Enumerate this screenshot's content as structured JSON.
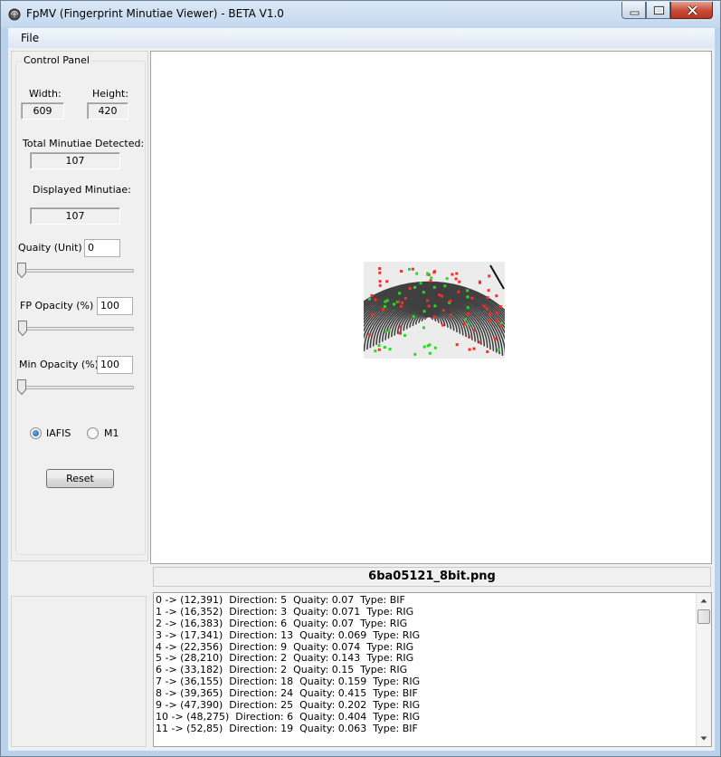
{
  "window": {
    "title": "FpMV (Fingerprint Minutiae Viewer) - BETA V1.0",
    "controls": [
      "minimize-icon",
      "maximize-icon",
      "close-icon"
    ]
  },
  "menu": {
    "file_label": "File"
  },
  "control_panel": {
    "title": "Control Panel",
    "width_label": "Width:",
    "width_value": "609",
    "height_label": "Height:",
    "height_value": "420",
    "total_label": "Total Minutiae Detected:",
    "total_value": "107",
    "displayed_label": "Displayed Minutiae:",
    "displayed_value": "107",
    "quality_label": "Quaity (Unit) >",
    "quality_value": "0",
    "quality_slider_level": 0,
    "fp_opacity_label": "FP Opacity (%)  >",
    "fp_opacity_value": "100",
    "fp_opacity_slider_level": 0,
    "min_opacity_label": "Min Opacity (%) >",
    "min_opacity_value": "100",
    "min_opacity_slider_level": 0,
    "radio_iafis_label": "IAFIS",
    "radio_m1_label": "M1",
    "selected_format": "IAFIS",
    "reset_label": "Reset"
  },
  "image": {
    "filename": "6ba05121_8bit.png",
    "marker_colors": {
      "bifurcation": "#ff2a2a",
      "ridge_ending": "#22dd22"
    }
  },
  "minutiae_list": [
    "0 -> (12,391)  Direction: 5  Quaity: 0.07  Type: BIF",
    "1 -> (16,352)  Direction: 3  Quaity: 0.071  Type: RIG",
    "2 -> (16,383)  Direction: 6  Quaity: 0.07  Type: RIG",
    "3 -> (17,341)  Direction: 13  Quaity: 0.069  Type: RIG",
    "4 -> (22,356)  Direction: 9  Quaity: 0.074  Type: RIG",
    "5 -> (28,210)  Direction: 2  Quaity: 0.143  Type: RIG",
    "6 -> (33,182)  Direction: 2  Quaity: 0.15  Type: RIG",
    "7 -> (36,155)  Direction: 18  Quaity: 0.159  Type: RIG",
    "8 -> (39,365)  Direction: 24  Quaity: 0.415  Type: BIF",
    "9 -> (47,390)  Direction: 25  Quaity: 0.202  Type: RIG",
    "10 -> (48,275)  Direction: 6  Quaity: 0.404  Type: RIG",
    "11 -> (52,85)  Direction: 19  Quaity: 0.063  Type: BIF"
  ]
}
